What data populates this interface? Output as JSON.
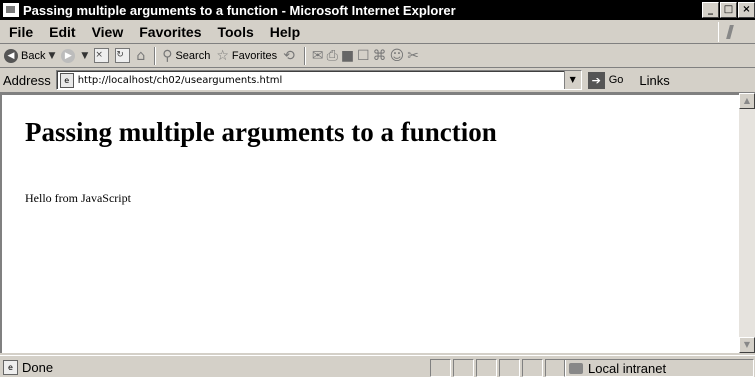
{
  "window": {
    "title": "Passing multiple arguments to a function - Microsoft Internet Explorer",
    "controls": {
      "minimize": "_",
      "maximize": "□",
      "close": "×"
    }
  },
  "menu": [
    "File",
    "Edit",
    "View",
    "Favorites",
    "Tools",
    "Help"
  ],
  "toolbar": {
    "back_label": "Back",
    "search_label": "Search",
    "favorites_label": "Favorites"
  },
  "address": {
    "label": "Address",
    "url": "http://localhost/ch02/usearguments.html",
    "go_label": "Go",
    "links_label": "Links"
  },
  "page": {
    "heading": "Passing multiple arguments to a function",
    "text": "Hello from JavaScript"
  },
  "status": {
    "text": "Done",
    "zone": "Local intranet"
  }
}
